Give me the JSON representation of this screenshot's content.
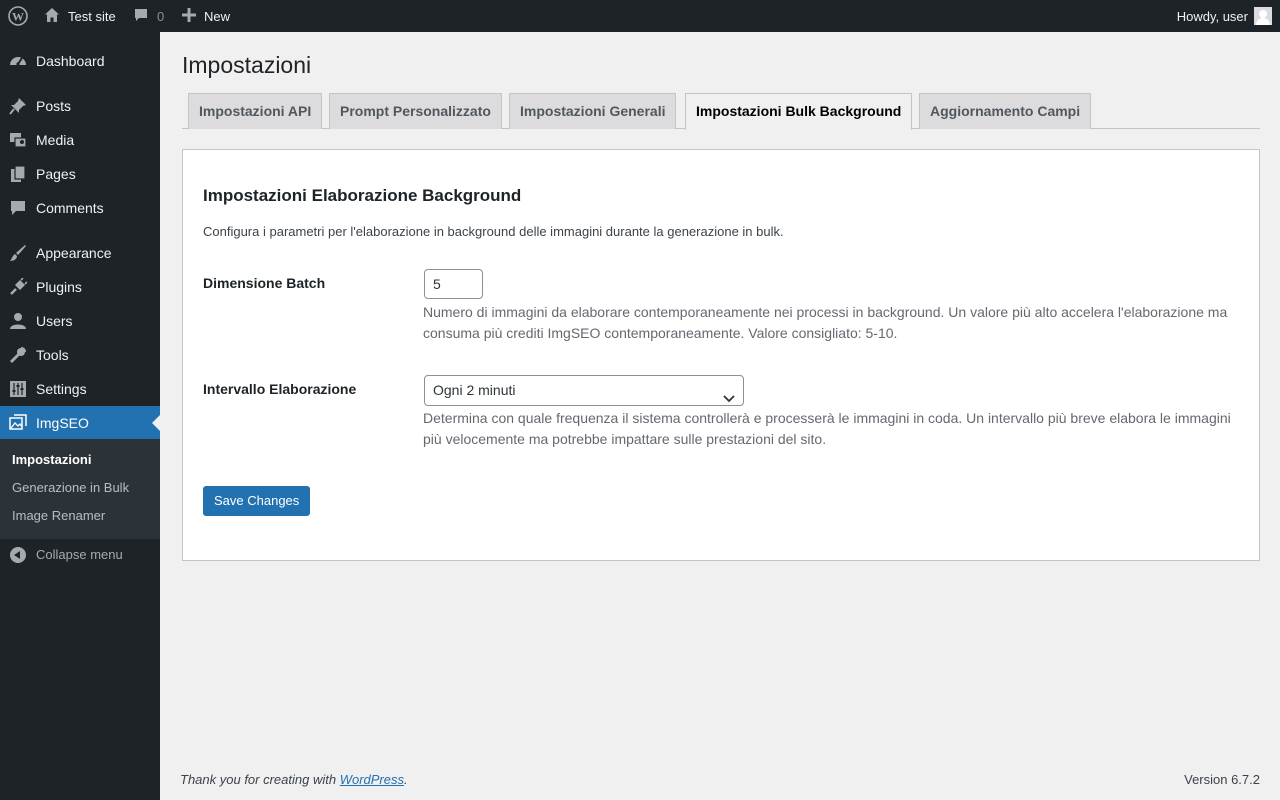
{
  "adminbar": {
    "site_name": "Test site",
    "comments_count": "0",
    "new_label": "New",
    "howdy": "Howdy, user"
  },
  "sidebar": {
    "items": [
      {
        "label": "Dashboard",
        "icon": "dashboard-icon"
      },
      {
        "label": "Posts",
        "icon": "pin-icon"
      },
      {
        "label": "Media",
        "icon": "media-icon"
      },
      {
        "label": "Pages",
        "icon": "pages-icon"
      },
      {
        "label": "Comments",
        "icon": "comment-icon"
      },
      {
        "label": "Appearance",
        "icon": "brush-icon"
      },
      {
        "label": "Plugins",
        "icon": "plug-icon"
      },
      {
        "label": "Users",
        "icon": "user-icon"
      },
      {
        "label": "Tools",
        "icon": "wrench-icon"
      },
      {
        "label": "Settings",
        "icon": "sliders-icon"
      },
      {
        "label": "ImgSEO",
        "icon": "images-icon"
      }
    ],
    "submenu": [
      "Impostazioni",
      "Generazione in Bulk",
      "Image Renamer"
    ],
    "collapse_label": "Collapse menu"
  },
  "page": {
    "title": "Impostazioni",
    "tabs": [
      "Impostazioni API",
      "Prompt Personalizzato",
      "Impostazioni Generali",
      "Impostazioni Bulk Background",
      "Aggiornamento Campi"
    ],
    "active_tab": "Impostazioni Bulk Background"
  },
  "section": {
    "heading": "Impostazioni Elaborazione Background",
    "description": "Configura i parametri per l'elaborazione in background delle immagini durante la generazione in bulk."
  },
  "fields": {
    "batch_label": "Dimensione Batch",
    "batch_value": "5",
    "batch_help": "Numero di immagini da elaborare contemporaneamente nei processi in background. Un valore più alto accelera l'elaborazione ma consuma più crediti ImgSEO contemporaneamente. Valore consigliato: 5-10.",
    "interval_label": "Intervallo Elaborazione",
    "interval_value": "Ogni 2 minuti",
    "interval_help": "Determina con quale frequenza il sistema controllerà e processerà le immagini in coda. Un intervallo più breve elabora le immagini più velocemente ma potrebbe impattare sulle prestazioni del sito."
  },
  "save_label": "Save Changes",
  "footer": {
    "thanks_prefix": "Thank you for creating with ",
    "thanks_link": "WordPress",
    "thanks_suffix": ".",
    "version": "Version 6.7.2"
  },
  "colors": {
    "sidebar_bg": "#1d2327",
    "accent": "#2271b1",
    "page_bg": "#f0f0f1"
  }
}
